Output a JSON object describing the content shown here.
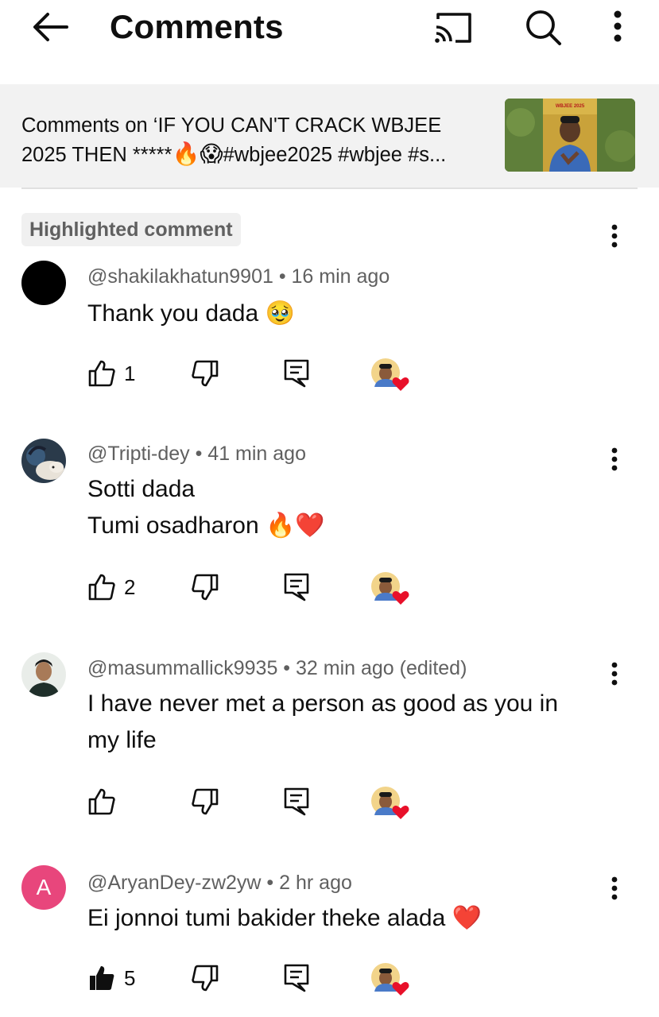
{
  "header": {
    "title": "Comments",
    "back_icon": "arrow-left-icon",
    "cast_icon": "cast-icon",
    "search_icon": "search-icon",
    "more_icon": "more-vertical-icon"
  },
  "video": {
    "line1": "Comments on ‘IF YOU CAN'T CRACK WBJEE",
    "line2_text": "2025 THEN *****",
    "line2_tags": "#wbjee2025 #wbjee #s...",
    "emoji1": "🔥",
    "emoji2": "😱",
    "thumbnail_text": "WBJEE 2025"
  },
  "highlight_label": "Highlighted comment",
  "comments": [
    {
      "handle": "@shakilakhatun9901",
      "time": "16 min ago",
      "lines": [
        "Thank you dada 🥹"
      ],
      "likes": "1",
      "liked": false
    },
    {
      "handle": "@Tripti-dey",
      "time": "41 min ago",
      "lines": [
        "Sotti dada",
        "Tumi osadharon 🔥❤️"
      ],
      "likes": "2",
      "liked": false
    },
    {
      "handle": "@masummallick9935",
      "time": "32 min ago (edited)",
      "lines": [
        "I have never met a person as  good as you in",
        "my life"
      ],
      "likes": "",
      "liked": false
    },
    {
      "handle": "@AryanDey-zw2yw",
      "time": "2 hr ago",
      "avatar_letter": "A",
      "lines": [
        "Ei jonnoi tumi bakider theke alada ❤️"
      ],
      "likes": "5",
      "liked": true
    }
  ],
  "colors": {
    "accent_avatar": "#e8467c",
    "heart": "#e8102a",
    "meta": "#606060"
  }
}
